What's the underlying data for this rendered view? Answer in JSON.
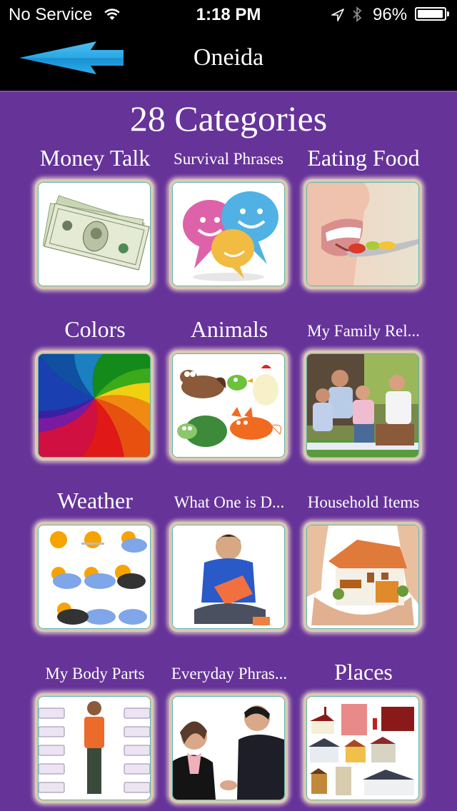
{
  "status_bar": {
    "carrier": "No Service",
    "time": "1:18 PM",
    "battery_percent_text": "96%",
    "battery_level": 0.96,
    "icons": [
      "wifi-icon",
      "location-arrow-icon",
      "bluetooth-icon",
      "battery-icon"
    ]
  },
  "nav": {
    "back_icon": "back-arrow-icon",
    "title": "Oneida"
  },
  "heading": "28 Categories",
  "colors": {
    "background": "#663399",
    "topbar": "#000000",
    "arrow": "#29a8e6"
  },
  "categories": [
    {
      "label": "Money Talk",
      "image": "money-image"
    },
    {
      "label": "Survival Phrases",
      "image": "speech-bubbles-image"
    },
    {
      "label": "Eating Food",
      "image": "eating-food-image"
    },
    {
      "label": "Colors",
      "image": "rainbow-swirl-image"
    },
    {
      "label": "Animals",
      "image": "cartoon-animals-image"
    },
    {
      "label": "My Family Rel...",
      "image": "family-picnic-image"
    },
    {
      "label": "Weather",
      "image": "weather-icons-image"
    },
    {
      "label": "What One is D...",
      "image": "boy-reading-image"
    },
    {
      "label": "Household Items",
      "image": "house-in-hands-image"
    },
    {
      "label": "My Body Parts",
      "image": "body-parts-diagram-image"
    },
    {
      "label": "Everyday Phras...",
      "image": "handshake-image"
    },
    {
      "label": "Places",
      "image": "buildings-image"
    }
  ]
}
